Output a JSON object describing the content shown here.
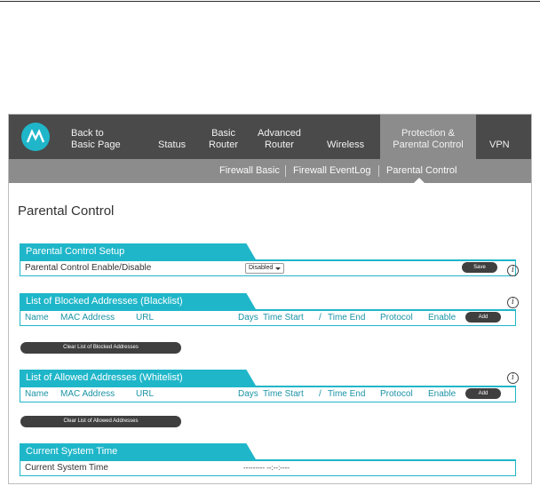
{
  "nav": {
    "items": [
      {
        "label": "Back to\nBasic Page"
      },
      {
        "label": "Status"
      },
      {
        "label": "Basic\nRouter"
      },
      {
        "label": "Advanced\nRouter"
      },
      {
        "label": "Wireless"
      },
      {
        "label": "Protection &\nParental Control"
      },
      {
        "label": "VPN"
      }
    ],
    "active_index": 5
  },
  "subnav": {
    "items": [
      "Firewall Basic",
      "Firewall EventLog",
      "Parental Control"
    ],
    "active": "Parental Control"
  },
  "page_title": "Parental Control",
  "setup": {
    "title": "Parental Control Setup",
    "row_label": "Parental Control Enable/Disable",
    "select_value": "Disabled",
    "save_label": "Save"
  },
  "blacklist": {
    "title": "List of Blocked Addresses (Blacklist)",
    "columns": [
      "Name",
      "MAC Address",
      "URL",
      "Days",
      "Time Start",
      "/",
      "Time End",
      "Protocol",
      "Enable"
    ],
    "add_label": "Add",
    "clear_label": "Clear List of Blocked Addresses"
  },
  "whitelist": {
    "title": "List of Allowed Addresses (Whitelist)",
    "columns": [
      "Name",
      "MAC Address",
      "URL",
      "Days",
      "Time Start",
      "/",
      "Time End",
      "Protocol",
      "Enable"
    ],
    "add_label": "Add",
    "clear_label": "Clear List of Allowed Addresses"
  },
  "system_time": {
    "title": "Current System Time",
    "row_label": "Current System Time",
    "value": "--------- --:--:----"
  },
  "info_glyph": "i",
  "colors": {
    "nav_bg": "#4a4a4a",
    "subnav_bg": "#8c8c8c",
    "accent": "#1fb6c9",
    "button": "#3f3f3f"
  },
  "icons": [
    "motorola-logo-icon",
    "info-icon"
  ]
}
